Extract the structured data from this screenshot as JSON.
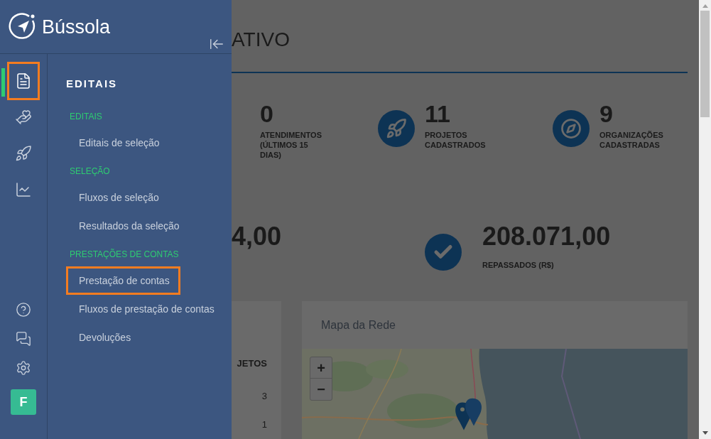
{
  "brand": "Bússola",
  "rail": {
    "items": [
      {
        "kind": "document",
        "selected": true,
        "highlighted": true
      },
      {
        "kind": "hand",
        "selected": false,
        "highlighted": false
      },
      {
        "kind": "rocket",
        "selected": false,
        "highlighted": false
      },
      {
        "kind": "chart",
        "selected": false,
        "highlighted": false
      }
    ],
    "bottom": [
      {
        "kind": "help"
      },
      {
        "kind": "chat"
      },
      {
        "kind": "settings"
      }
    ],
    "avatar": "F"
  },
  "menu": {
    "title": "EDITAIS",
    "sections": [
      {
        "label": "EDITAIS",
        "items": [
          {
            "label": "Editais de seleção",
            "highlighted": false
          }
        ]
      },
      {
        "label": "SELEÇÃO",
        "items": [
          {
            "label": "Fluxos de seleção",
            "highlighted": false
          },
          {
            "label": "Resultados da seleção",
            "highlighted": false
          }
        ]
      },
      {
        "label": "PRESTAÇÕES DE CONTAS",
        "items": [
          {
            "label": "Prestação de contas",
            "highlighted": true
          },
          {
            "label": "Fluxos de prestação de contas",
            "highlighted": false
          },
          {
            "label": "Devoluções",
            "highlighted": false
          }
        ]
      }
    ]
  },
  "page": {
    "title": "ATIVO",
    "stats": [
      {
        "kind": "none",
        "value": "0",
        "label": "ATENDIMENTOS (ÚLTIMOS 15 DIAS)"
      },
      {
        "kind": "rocket",
        "value": "11",
        "label": "PROJETOS CADASTRADOS"
      },
      {
        "kind": "compass",
        "value": "9",
        "label": "ORGANIZAÇÕES CADASTRADAS"
      }
    ],
    "amounts": [
      {
        "kind": "none",
        "value": "4,00"
      },
      {
        "kind": "check",
        "value": "208.071,00",
        "label": "REPASSADOS (R$)"
      }
    ],
    "table": {
      "column": "JETOS",
      "cells": [
        "3",
        "1"
      ]
    },
    "map": {
      "title": "Mapa da Rede",
      "zoom_in": "+",
      "zoom_out": "−"
    }
  }
}
